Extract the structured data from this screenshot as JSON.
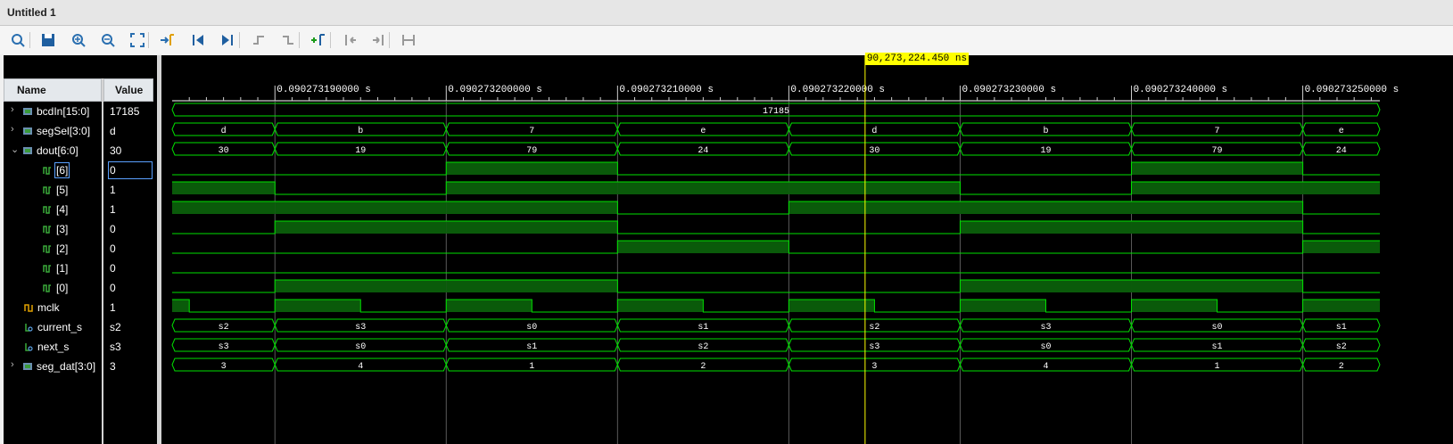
{
  "window": {
    "title": "Untitled 1"
  },
  "toolbar": {
    "buttons": [
      {
        "name": "search-icon"
      },
      {
        "name": "save-icon"
      },
      {
        "name": "zoom-in-icon"
      },
      {
        "name": "zoom-out-icon"
      },
      {
        "name": "zoom-fit-icon"
      },
      {
        "name": "go-to-cursor-icon"
      },
      {
        "name": "go-to-start-icon"
      },
      {
        "name": "go-to-end-icon"
      },
      {
        "name": "previous-transition-icon"
      },
      {
        "name": "next-transition-icon"
      },
      {
        "name": "add-marker-icon"
      },
      {
        "name": "previous-marker-icon"
      },
      {
        "name": "next-marker-icon"
      },
      {
        "name": "swap-cursors-icon"
      }
    ]
  },
  "columns": {
    "name": "Name",
    "value": "Value"
  },
  "signals": [
    {
      "name": "bcdIn[15:0]",
      "value": "17185",
      "expand": "›",
      "icon": "bus-icon"
    },
    {
      "name": "segSel[3:0]",
      "value": "d",
      "expand": "›",
      "icon": "bus-icon"
    },
    {
      "name": "dout[6:0]",
      "value": "30",
      "expand": "⌄",
      "icon": "bus-icon"
    },
    {
      "name": "[6]",
      "value": "0",
      "icon": "bit-icon"
    },
    {
      "name": "[5]",
      "value": "1",
      "icon": "bit-icon"
    },
    {
      "name": "[4]",
      "value": "1",
      "icon": "bit-icon"
    },
    {
      "name": "[3]",
      "value": "0",
      "icon": "bit-icon"
    },
    {
      "name": "[2]",
      "value": "0",
      "icon": "bit-icon"
    },
    {
      "name": "[1]",
      "value": "0",
      "icon": "bit-icon"
    },
    {
      "name": "[0]",
      "value": "0",
      "icon": "bit-icon"
    },
    {
      "name": "mclk",
      "value": "1",
      "icon": "clock-icon"
    },
    {
      "name": "current_s",
      "value": "s2",
      "icon": "enum-icon"
    },
    {
      "name": "next_s",
      "value": "s3",
      "icon": "enum-icon"
    },
    {
      "name": "seg_dat[3:0]",
      "value": "3",
      "expand": "›",
      "icon": "bus-icon"
    }
  ],
  "cursor": {
    "label": "90,273,224.450 ns",
    "time_s": 0.09027322445
  },
  "time_axis": {
    "ticks": [
      "0.090273190000 s",
      "0.090273200000 s",
      "0.090273210000 s",
      "0.090273220000 s",
      "0.090273230000 s",
      "0.090273240000 s",
      "0.090273250000 s"
    ],
    "tick_times_ns": [
      90273190,
      90273200,
      90273210,
      90273220,
      90273230,
      90273240,
      90273250
    ],
    "view_start_ns": 90273184,
    "view_end_ns": 90273254.5
  },
  "waves": {
    "boundaries_ns": [
      90273184,
      90273190,
      90273200,
      90273210,
      90273220,
      90273230,
      90273240,
      90273250,
      90273254.5
    ],
    "bcdIn": [
      "17185"
    ],
    "segSel": [
      "d",
      "b",
      "7",
      "e",
      "d",
      "b",
      "7",
      "e"
    ],
    "dout": [
      "30",
      "19",
      "79",
      "24",
      "30",
      "19",
      "79",
      "24"
    ],
    "bits": {
      "6": [
        0,
        0,
        1,
        0,
        0,
        0,
        1,
        0
      ],
      "5": [
        1,
        0,
        1,
        1,
        1,
        0,
        1,
        1
      ],
      "4": [
        1,
        1,
        1,
        0,
        1,
        1,
        1,
        0
      ],
      "3": [
        0,
        1,
        1,
        0,
        0,
        1,
        1,
        0
      ],
      "2": [
        0,
        0,
        0,
        1,
        0,
        0,
        0,
        1
      ],
      "1": [
        0,
        0,
        0,
        0,
        0,
        0,
        0,
        0
      ],
      "0": [
        0,
        1,
        1,
        0,
        0,
        1,
        1,
        0
      ]
    },
    "mclk_edges_ns": [
      90273185,
      90273190,
      90273195,
      90273200,
      90273205,
      90273210,
      90273215,
      90273220,
      90273225,
      90273230,
      90273235,
      90273240,
      90273245,
      90273250
    ],
    "current_s": [
      "s2",
      "s3",
      "s0",
      "s1",
      "s2",
      "s3",
      "s0",
      "s1"
    ],
    "next_s": [
      "s3",
      "s0",
      "s1",
      "s2",
      "s3",
      "s0",
      "s1",
      "s2"
    ],
    "seg_dat": [
      "3",
      "4",
      "1",
      "2",
      "3",
      "4",
      "1",
      "2"
    ]
  },
  "colors": {
    "wave": "#00e000",
    "fill": "#0a5a0a",
    "cursor": "#ffff00",
    "axis": "#ffffff"
  }
}
